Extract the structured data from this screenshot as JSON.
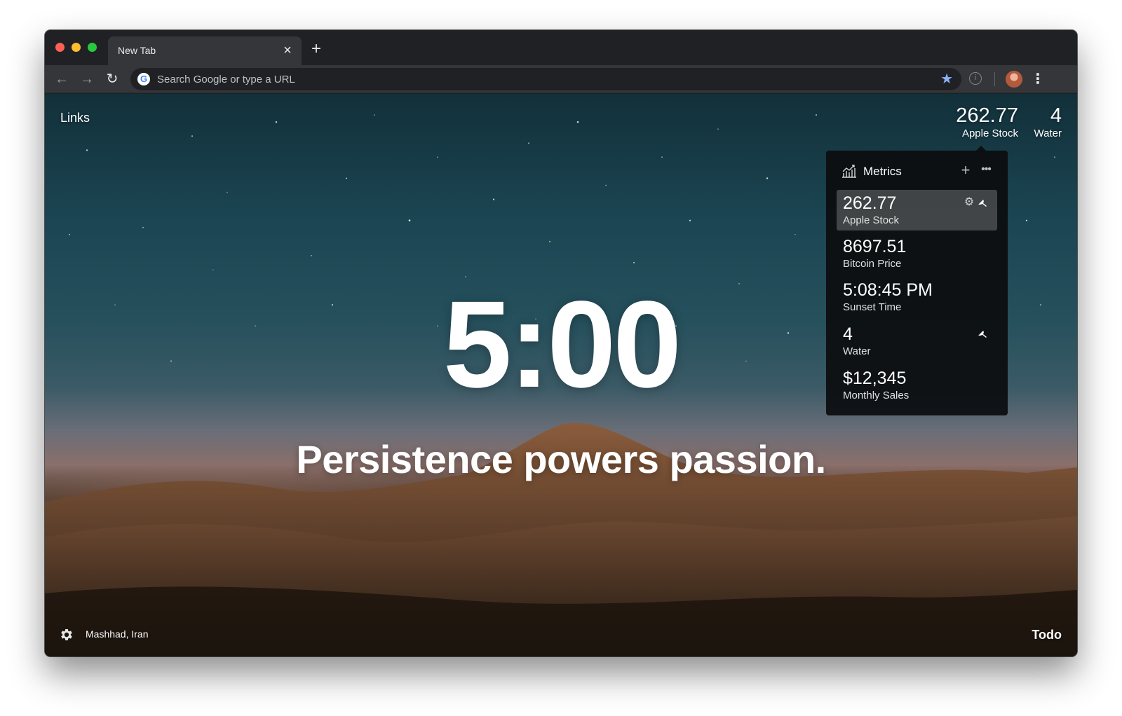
{
  "browser": {
    "tab_title": "New Tab",
    "tab_close_glyph": "×",
    "new_tab_glyph": "+",
    "back_glyph": "←",
    "forward_glyph": "→",
    "reload_glyph": "↻",
    "search_placeholder": "Search Google or type a URL",
    "google_logo_letter": "G",
    "bookmark_glyph": "★",
    "info_glyph": "i",
    "menu_glyph": "⋮",
    "icons": [
      "back-arrow-icon",
      "forward-arrow-icon",
      "reload-icon",
      "google-icon",
      "bookmark-star-icon",
      "info-icon",
      "profile-avatar",
      "kebab-menu-icon"
    ]
  },
  "dashboard": {
    "links_label": "Links",
    "top_metrics": [
      {
        "value": "262.77",
        "label": "Apple Stock"
      },
      {
        "value": "4",
        "label": "Water"
      }
    ],
    "clock": "5:00",
    "mantra": "Persistence powers passion.",
    "location": "Mashhad, Iran",
    "todo_label": "Todo"
  },
  "metrics_panel": {
    "title": "Metrics",
    "add_glyph": "+",
    "more_glyph": "•••",
    "items": [
      {
        "value": "262.77",
        "label": "Apple Stock",
        "active": true,
        "pinned": true
      },
      {
        "value": "8697.51",
        "label": "Bitcoin Price",
        "active": false,
        "pinned": false
      },
      {
        "value": "5:08:45 PM",
        "label": "Sunset Time",
        "active": false,
        "pinned": false
      },
      {
        "value": "4",
        "label": "Water",
        "active": false,
        "pinned": true
      },
      {
        "value": "$12,345",
        "label": "Monthly Sales",
        "active": false,
        "pinned": false
      }
    ],
    "settings_glyph": "⚙"
  },
  "colors": {
    "window_bg": "#202124",
    "toolbar_bg": "#35363a",
    "bookmark_star": "#8ab4f8",
    "panel_bg": "#0c0d0f"
  }
}
